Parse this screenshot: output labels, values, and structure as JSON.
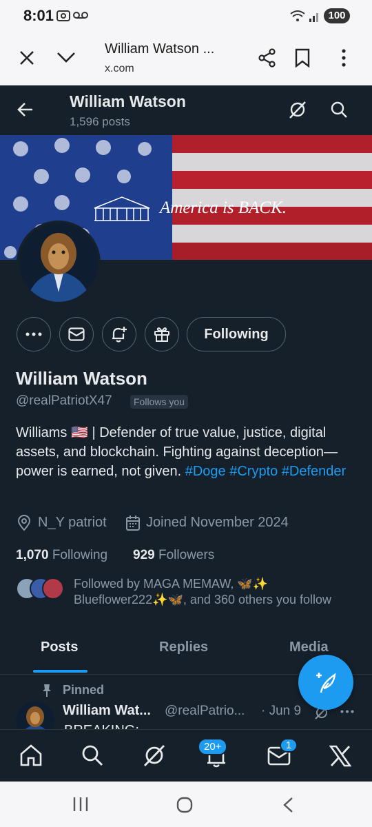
{
  "status_bar": {
    "time": "8:01",
    "battery": "100"
  },
  "browser": {
    "page_title": "William Watson ...",
    "url": "x.com"
  },
  "header": {
    "name": "William Watson",
    "post_count": "1,596 posts"
  },
  "banner": {
    "text": "America is BACK."
  },
  "actions": {
    "following_label": "Following"
  },
  "profile": {
    "name": "William Watson",
    "handle": "@realPatriotX47",
    "follows_you": "Follows you",
    "bio_main": "Williams 🇺🇸 | Defender of true value, justice, digital assets, and blockchain. Fighting against deception—power is earned, not given.",
    "hashtags": [
      "#Doge",
      "#Crypto",
      "#Defender"
    ],
    "location": "N_Y patriot",
    "joined": "Joined November 2024",
    "following_count": "1,070",
    "following_label": "Following",
    "followers_count": "929",
    "followers_label": "Followers",
    "followed_by_line1": "Followed by MAGA MEMAW, 🦋✨",
    "followed_by_line2": "Blueflower222✨🦋, and 360 others you follow"
  },
  "tabs": [
    "Posts",
    "Replies",
    "Media"
  ],
  "pinned_post": {
    "pinned_label": "Pinned",
    "author": "William Wat...",
    "handle": "@realPatrio...",
    "date": "· Jun 9",
    "text_preview": "BREAKING: ..."
  },
  "bottom_nav": {
    "notifications_badge": "20+",
    "messages_badge": "1",
    "x_label": "X"
  },
  "colors": {
    "background": "#15202b",
    "accent": "#1d9bf0",
    "muted": "#8b98a5"
  }
}
